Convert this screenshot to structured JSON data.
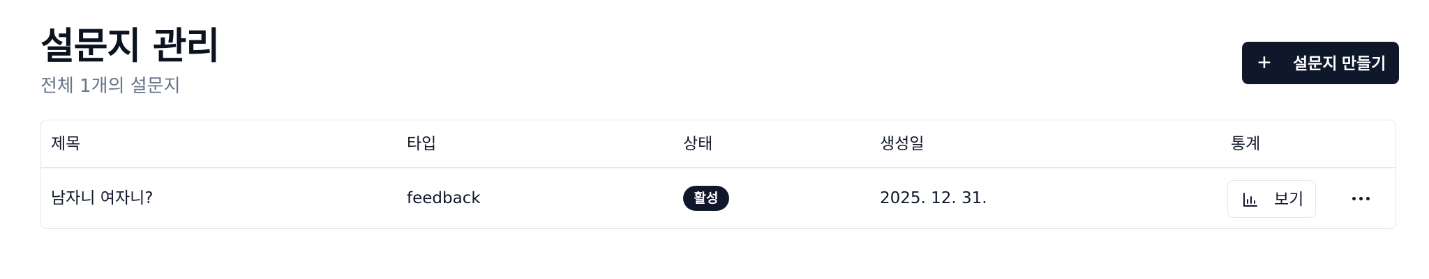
{
  "header": {
    "title": "설문지 관리",
    "subtitle": "전체 1개의 설문지",
    "create_button": {
      "icon": "plus-icon",
      "symbol": "+",
      "label": "설문지 만들기"
    }
  },
  "table": {
    "columns": [
      "제목",
      "타입",
      "상태",
      "생성일",
      "통계"
    ],
    "rows": [
      {
        "title": "남자니 여자니?",
        "type": "feedback",
        "status": "활성",
        "created": "2025. 12. 31.",
        "stats_button": {
          "icon": "bar-chart-icon",
          "label": "보기"
        },
        "more_icon": "more-horizontal-icon"
      }
    ]
  },
  "colors": {
    "primary": "#0f172a",
    "muted_text": "#64748b",
    "border": "#e2e8f0",
    "background": "#ffffff"
  }
}
